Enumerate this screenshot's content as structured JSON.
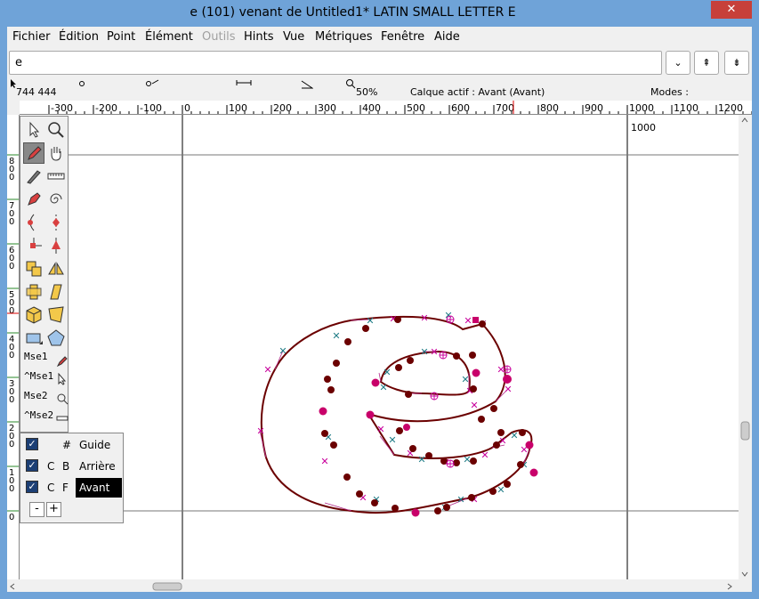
{
  "window": {
    "title": "e (101) venant de Untitled1* LATIN SMALL LETTER E",
    "close_label": "✕"
  },
  "menu": [
    "Fichier",
    "Édition",
    "Point",
    "Élément",
    "Outils",
    "Hints",
    "Vue",
    "Métriques",
    "Fenêtre",
    "Aide"
  ],
  "menu_disabled": "Outils",
  "glyph_field": {
    "value": "e"
  },
  "nav": {
    "dropdown": "⌄",
    "prev": "⇞",
    "next": "⇟"
  },
  "info": {
    "coords": "744 444",
    "zoom": "50%",
    "active_layer": "Calque actif : Avant (Avant)",
    "modes": "Modes :"
  },
  "ruler": {
    "h_labels": [
      "-300",
      "-200",
      "-100",
      "0",
      "100",
      "200",
      "300",
      "400",
      "500",
      "600",
      "700",
      "800",
      "900",
      "1000",
      "1100",
      "1200"
    ],
    "v_labels": [
      "800",
      "700",
      "600",
      "500",
      "400",
      "300",
      "200",
      "100",
      "0"
    ]
  },
  "canvas": {
    "advance_label": "1000"
  },
  "tools": [
    "pointer-tool",
    "magnify-tool",
    "freehand-tool",
    "hand-tool",
    "knife-tool",
    "ruler-tool",
    "pen-tool",
    "spiro-tool",
    "curve-point-tool",
    "hv-curve-point-tool",
    "corner-point-tool",
    "tangent-point-tool",
    "scale-tool",
    "flip-tool",
    "rotate-tool",
    "skew-tool",
    "3d-rotate-tool",
    "perspective-tool",
    "rectangle-tool",
    "polygon-tool"
  ],
  "mse": [
    "Mse1",
    "^Mse1",
    "Mse2",
    "^Mse2"
  ],
  "layers": [
    {
      "q": "",
      "c": "#",
      "name": "Guide"
    },
    {
      "q": "C",
      "c": "B",
      "name": "Arrière"
    },
    {
      "q": "C",
      "c": "F",
      "name": "Avant"
    }
  ],
  "layer_buttons": {
    "minus": "-",
    "plus": "+"
  },
  "colors": {
    "outline": "#6b0000",
    "offcurve_magenta": "#c8009c",
    "offcurve_teal": "#1f7c86",
    "selected_point": "#c8006a",
    "titlebar": "#6fa3d8",
    "close_button": "#c7403a",
    "layer_checkbox": "#1c3f75"
  }
}
